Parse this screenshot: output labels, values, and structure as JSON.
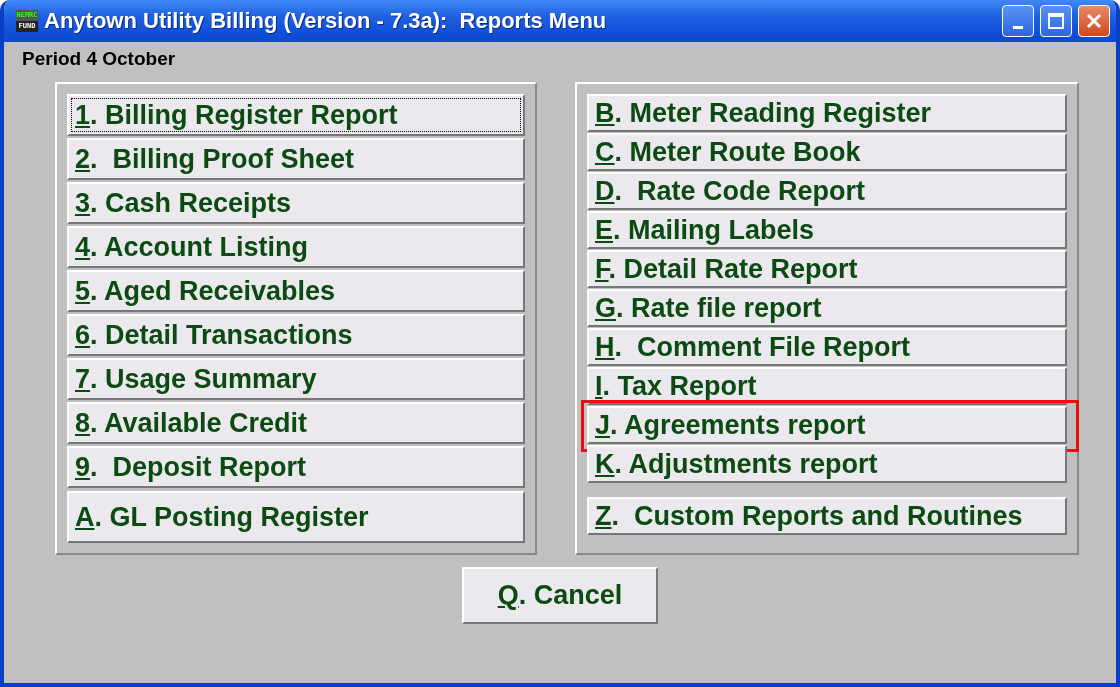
{
  "window": {
    "title": "Anytown Utility Billing (Version - 7.3a):  Reports Menu",
    "app_icon": [
      "NEMRC",
      "FUND"
    ]
  },
  "period": "Period 4 October",
  "left_buttons": [
    {
      "key": "1",
      "label": ". Billing Register Report",
      "focused": true,
      "highlighted": false
    },
    {
      "key": "2",
      "label": ".  Billing Proof Sheet",
      "focused": false,
      "highlighted": false
    },
    {
      "key": "3",
      "label": ". Cash Receipts",
      "focused": false,
      "highlighted": false
    },
    {
      "key": "4",
      "label": ". Account Listing",
      "focused": false,
      "highlighted": false
    },
    {
      "key": "5",
      "label": ". Aged Receivables",
      "focused": false,
      "highlighted": false
    },
    {
      "key": "6",
      "label": ". Detail Transactions",
      "focused": false,
      "highlighted": false
    },
    {
      "key": "7",
      "label": ". Usage Summary",
      "focused": false,
      "highlighted": false
    },
    {
      "key": "8",
      "label": ". Available Credit",
      "focused": false,
      "highlighted": false
    },
    {
      "key": "9",
      "label": ".  Deposit Report",
      "focused": false,
      "highlighted": false
    },
    {
      "key": "A",
      "label": ". GL Posting Register",
      "focused": false,
      "highlighted": false
    }
  ],
  "right_buttons": [
    {
      "key": "B",
      "label": ". Meter Reading Register",
      "focused": false,
      "highlighted": false
    },
    {
      "key": "C",
      "label": ". Meter Route Book",
      "focused": false,
      "highlighted": false
    },
    {
      "key": "D",
      "label": ".  Rate Code Report",
      "focused": false,
      "highlighted": false
    },
    {
      "key": "E",
      "label": ". Mailing Labels",
      "focused": false,
      "highlighted": false
    },
    {
      "key": "F",
      "label": ". Detail Rate Report",
      "focused": false,
      "highlighted": false
    },
    {
      "key": "G",
      "label": ". Rate file report",
      "focused": false,
      "highlighted": false
    },
    {
      "key": "H",
      "label": ".  Comment File Report",
      "focused": false,
      "highlighted": false
    },
    {
      "key": "I",
      "label": ". Tax Report",
      "focused": false,
      "highlighted": false
    },
    {
      "key": "J",
      "label": ". Agreements report",
      "focused": false,
      "highlighted": true
    },
    {
      "key": "K",
      "label": ". Adjustments report",
      "focused": false,
      "highlighted": false
    },
    {
      "key": "Z",
      "label": ".  Custom Reports and Routines",
      "focused": false,
      "highlighted": false
    }
  ],
  "cancel_button": {
    "key": "Q",
    "label": ". Cancel"
  }
}
